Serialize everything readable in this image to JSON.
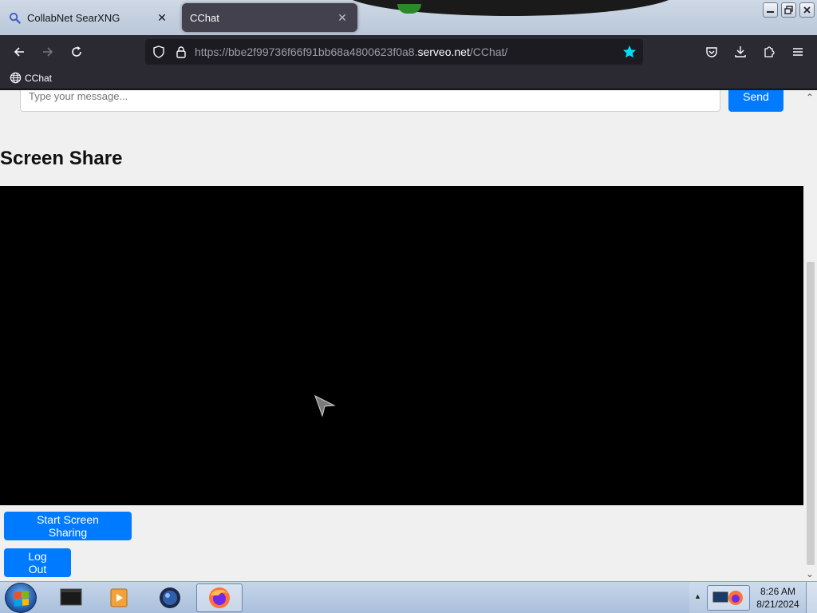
{
  "browser": {
    "tabs": [
      {
        "title": "CollabNet SearXNG",
        "active": false,
        "icon": "search-icon"
      },
      {
        "title": "CChat",
        "active": true,
        "icon": "none"
      }
    ],
    "url_prefix": "https://bbe2f99736f66f91bb68a4800623f0a8.",
    "url_domain": "serveo.net",
    "url_path": "/CChat/",
    "bookmarks": [
      {
        "label": "CChat",
        "icon": "globe-icon"
      }
    ]
  },
  "page": {
    "message_placeholder": "Type your message...",
    "send_label": "Send",
    "section_title": "Screen Share",
    "start_share_label": "Start Screen Sharing",
    "logout_label": "Log Out"
  },
  "taskbar": {
    "items": [
      "terminal-icon",
      "media-player-icon",
      "globe-app-icon",
      "firefox-icon"
    ],
    "active_item": "firefox-icon",
    "time": "8:26 AM",
    "date": "8/21/2024"
  },
  "colors": {
    "accent": "#007bff",
    "bookmark_star": "#00ddff",
    "video_bg": "#000000"
  }
}
